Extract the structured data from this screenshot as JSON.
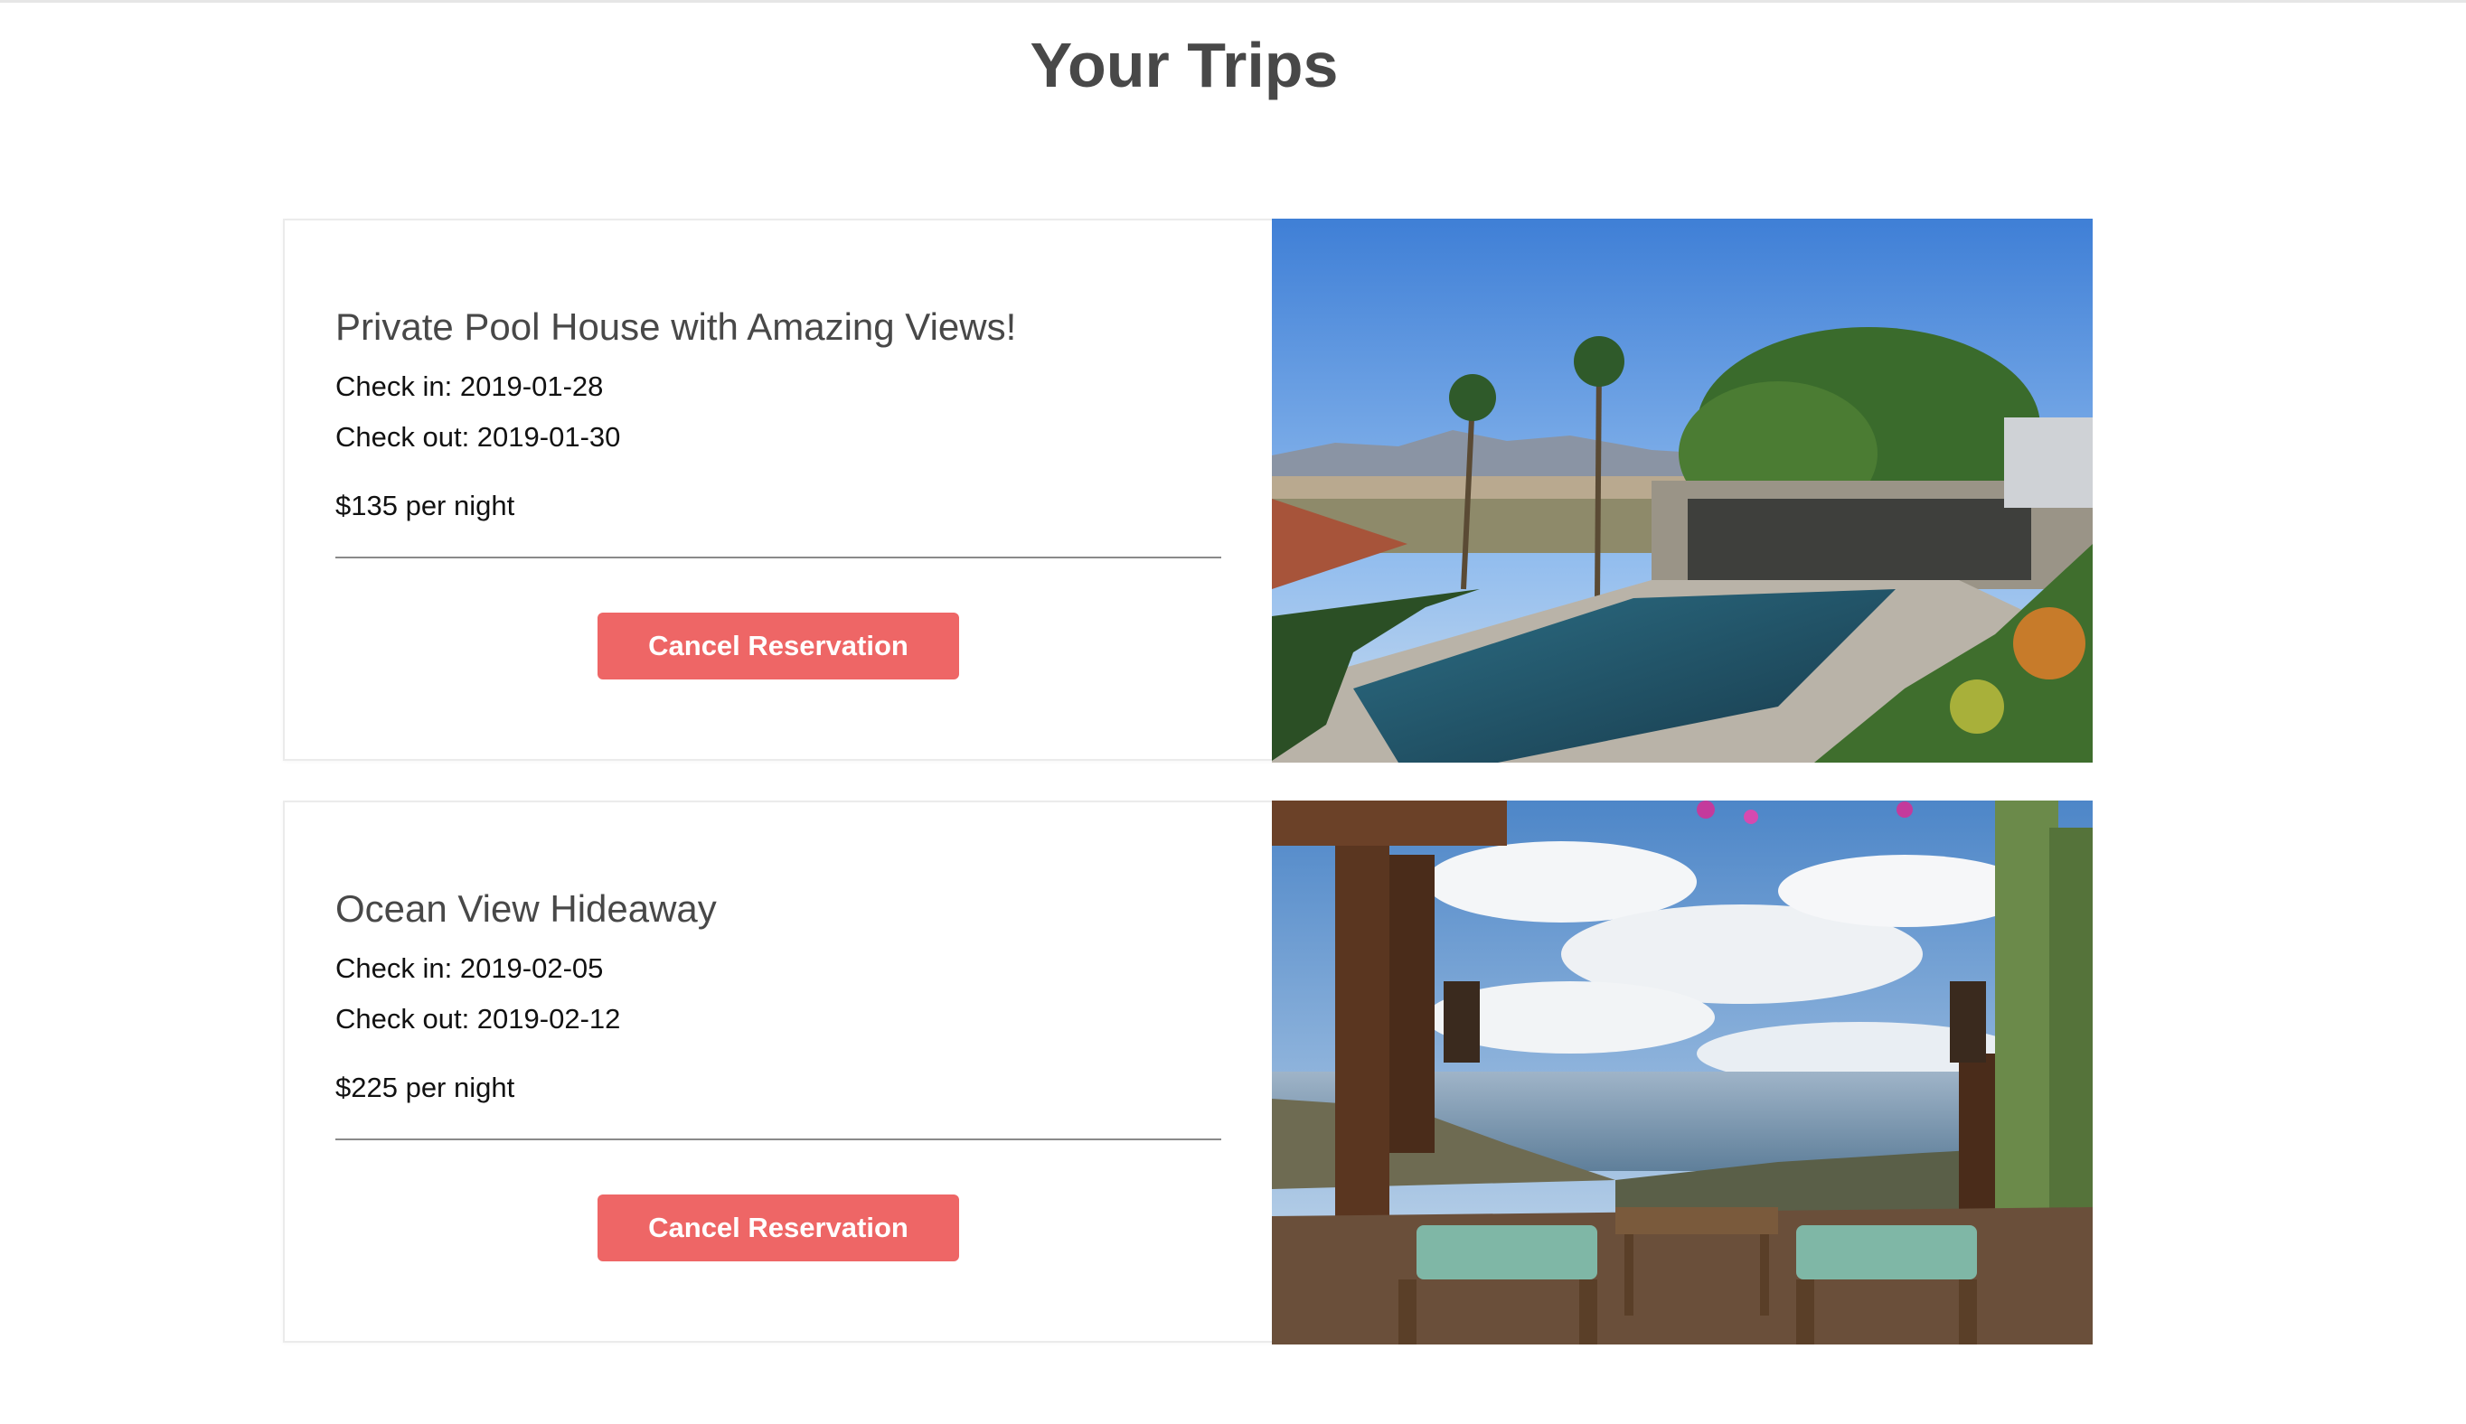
{
  "page": {
    "title": "Your Trips"
  },
  "trips": [
    {
      "name": "Private Pool House with Amazing Views!",
      "check_in": "Check in: 2019-01-28",
      "check_out": "Check out: 2019-01-30",
      "price": "$135 per night",
      "cancel_label": "Cancel Reservation",
      "photo_alt": "pool-house-photo"
    },
    {
      "name": "Ocean View Hideaway",
      "check_in": "Check in: 2019-02-05",
      "check_out": "Check out: 2019-02-12",
      "price": "$225 per night",
      "cancel_label": "Cancel Reservation",
      "photo_alt": "ocean-view-photo"
    }
  ],
  "colors": {
    "accent": "#ee6666",
    "title": "#484848",
    "border": "#ebebeb"
  }
}
